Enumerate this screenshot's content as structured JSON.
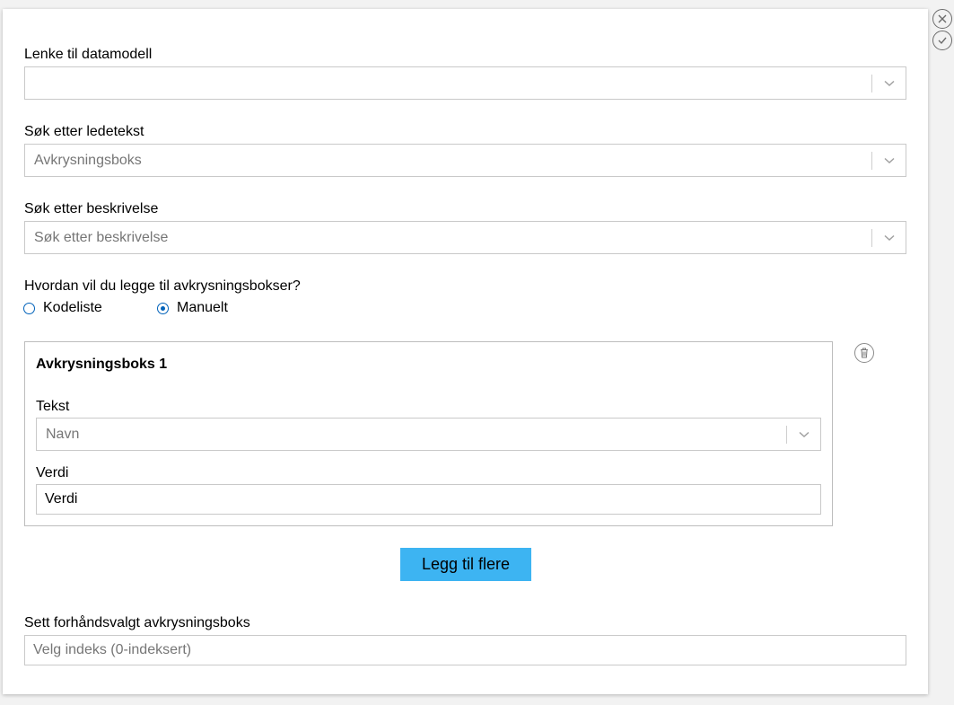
{
  "form": {
    "datamodel": {
      "label": "Lenke til datamodell",
      "value": ""
    },
    "ledetekst": {
      "label": "Søk etter ledetekst",
      "value": "Avkrysningsboks"
    },
    "beskrivelse": {
      "label": "Søk etter beskrivelse",
      "placeholder": "Søk etter beskrivelse"
    },
    "add_method": {
      "question": "Hvordan vil du legge til avkrysningsbokser?",
      "options": [
        {
          "label": "Kodeliste",
          "selected": false
        },
        {
          "label": "Manuelt",
          "selected": true
        }
      ]
    },
    "checkbox_card": {
      "title": "Avkrysningsboks 1",
      "tekst_label": "Tekst",
      "tekst_value": "Navn",
      "verdi_label": "Verdi",
      "verdi_value": "Verdi"
    },
    "add_more_label": "Legg til flere",
    "preselected": {
      "label": "Sett forhåndsvalgt avkrysningsboks",
      "placeholder": "Velg indeks (0-indeksert)"
    }
  },
  "icons": {
    "close": "close-icon",
    "confirm": "check-icon",
    "delete": "trash-icon",
    "dropdown": "chevron-down-icon"
  },
  "colors": {
    "accent_button": "#3db4f2",
    "radio": "#0062ba"
  }
}
